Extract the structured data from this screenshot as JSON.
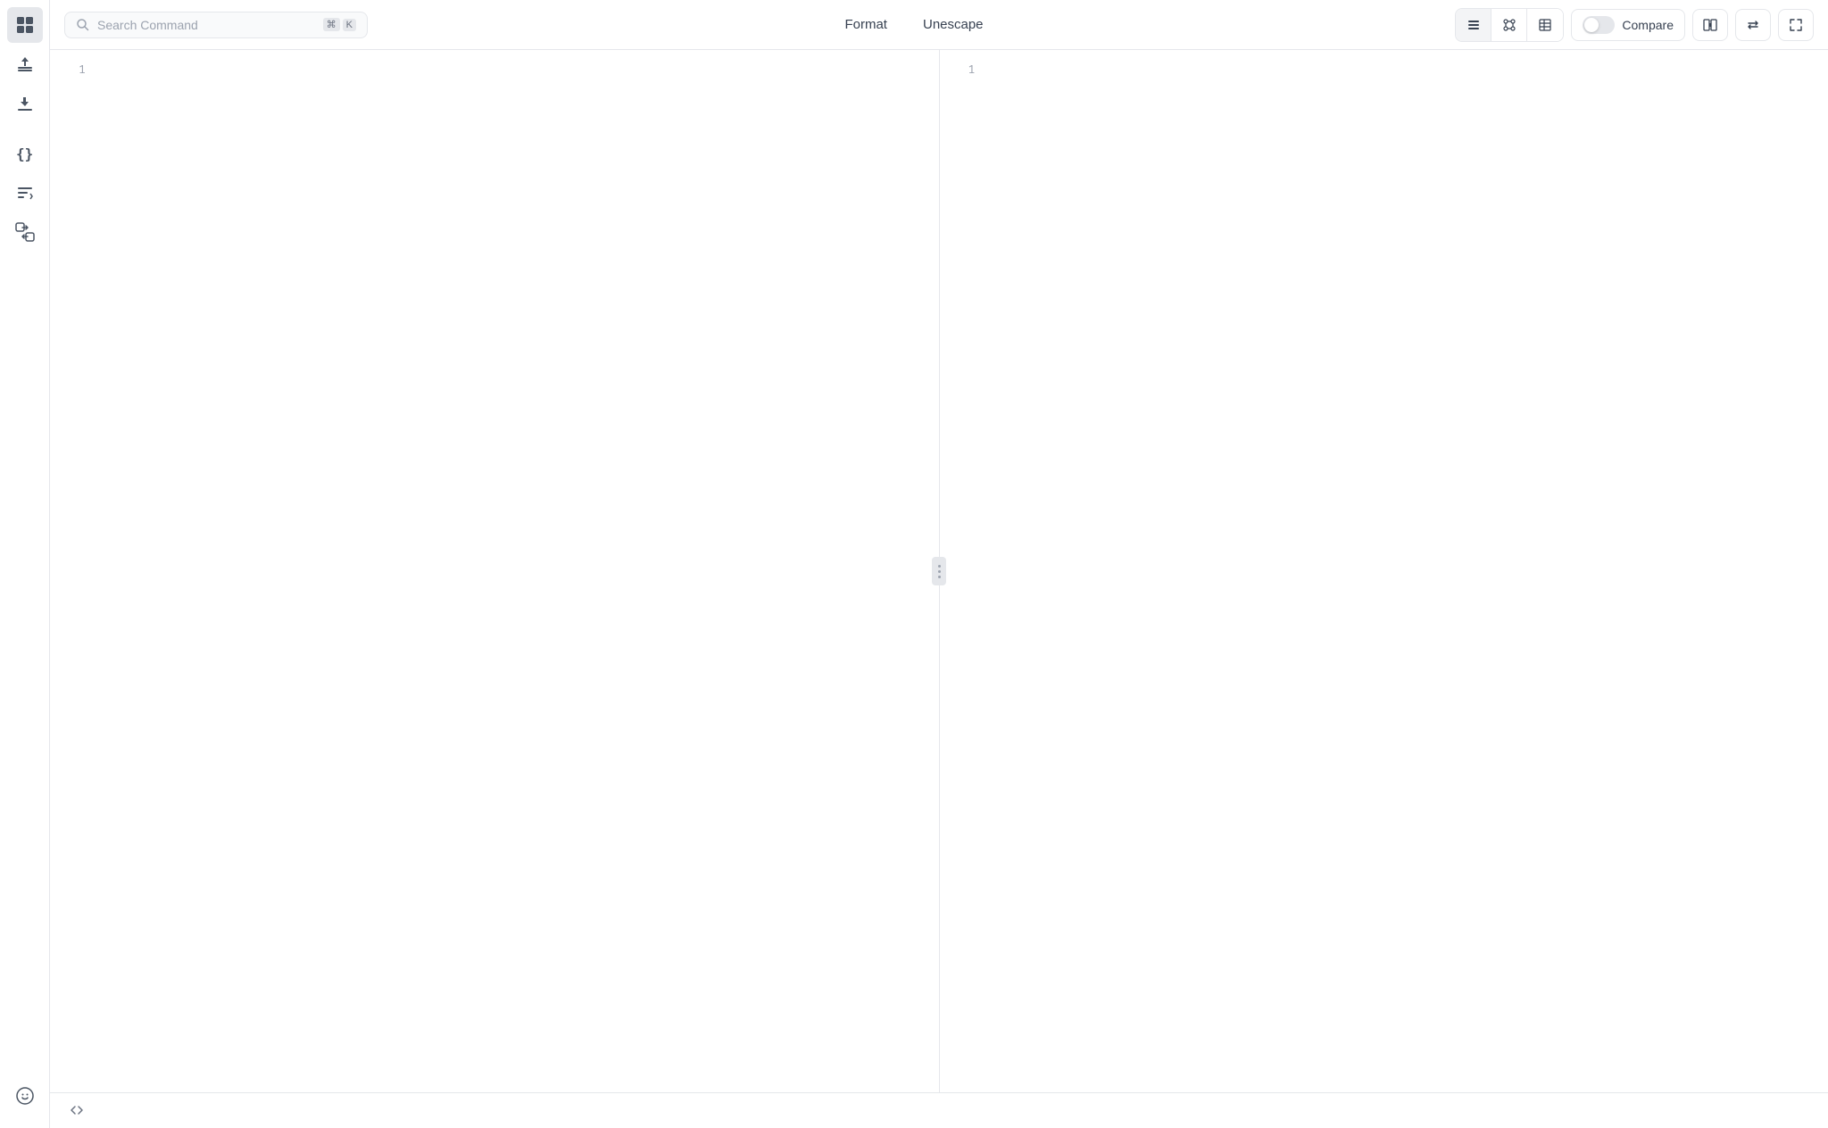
{
  "sidebar": {
    "icons": [
      {
        "name": "app-icon",
        "label": "App"
      },
      {
        "name": "upload-icon",
        "label": "Upload"
      },
      {
        "name": "download-icon",
        "label": "Download"
      },
      {
        "name": "braces-icon",
        "label": "JSON Braces"
      },
      {
        "name": "sort-icon",
        "label": "Sort"
      },
      {
        "name": "transform-icon",
        "label": "Transform"
      }
    ],
    "bottom_icons": [
      {
        "name": "feedback-icon",
        "label": "Feedback"
      }
    ]
  },
  "toolbar": {
    "search_placeholder": "Search Command",
    "shortcut_symbol": "⌘",
    "shortcut_key": "K",
    "format_label": "Format",
    "unescape_label": "Unescape",
    "view_modes": [
      "list",
      "tree",
      "table"
    ],
    "compare_label": "Compare",
    "compare_active": false
  },
  "editor": {
    "left_pane": {
      "line_numbers": [
        "1"
      ],
      "content": ""
    },
    "right_pane": {
      "line_numbers": [
        "1"
      ],
      "content": ""
    }
  },
  "bottom_bar": {
    "expand_label": "Expand"
  }
}
